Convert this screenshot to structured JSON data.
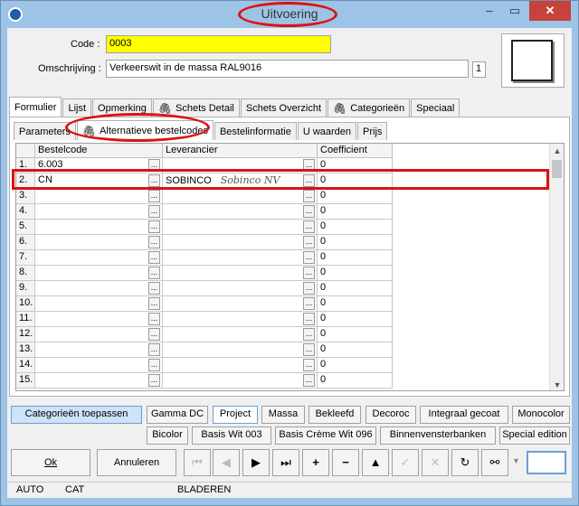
{
  "window": {
    "title": "Uitvoering",
    "close_glyph": "✕",
    "min_glyph": "–",
    "max_glyph": "▭"
  },
  "form": {
    "code_label": "Code :",
    "code_value": "0003",
    "omschrijving_label": "Omschrijving :",
    "omschrijving_value": "Verkeerswit in de massa RAL9016",
    "counter": "1"
  },
  "main_tabs": [
    "Formulier",
    "Lijst",
    "Opmerking",
    "Schets Detail",
    "Schets Overzicht",
    "Categorieën",
    "Speciaal"
  ],
  "sub_tabs": [
    "Parameters",
    "Alternatieve bestelcodes",
    "Bestelinformatie",
    "U waarden",
    "Prijs"
  ],
  "grid": {
    "headers": [
      "Bestelcode",
      "Leverancier",
      "Coefficient"
    ],
    "rows": [
      {
        "n": "1.",
        "code": "6.003",
        "lev": "",
        "lev2": "",
        "coef": "0"
      },
      {
        "n": "2.",
        "code": "CN",
        "lev": "SOBINCO",
        "lev2": "Sobinco NV",
        "coef": "0"
      },
      {
        "n": "3.",
        "code": "",
        "lev": "",
        "lev2": "",
        "coef": "0"
      },
      {
        "n": "4.",
        "code": "",
        "lev": "",
        "lev2": "",
        "coef": "0"
      },
      {
        "n": "5.",
        "code": "",
        "lev": "",
        "lev2": "",
        "coef": "0"
      },
      {
        "n": "6.",
        "code": "",
        "lev": "",
        "lev2": "",
        "coef": "0"
      },
      {
        "n": "7.",
        "code": "",
        "lev": "",
        "lev2": "",
        "coef": "0"
      },
      {
        "n": "8.",
        "code": "",
        "lev": "",
        "lev2": "",
        "coef": "0"
      },
      {
        "n": "9.",
        "code": "",
        "lev": "",
        "lev2": "",
        "coef": "0"
      },
      {
        "n": "10.",
        "code": "",
        "lev": "",
        "lev2": "",
        "coef": "0"
      },
      {
        "n": "11.",
        "code": "",
        "lev": "",
        "lev2": "",
        "coef": "0"
      },
      {
        "n": "12.",
        "code": "",
        "lev": "",
        "lev2": "",
        "coef": "0"
      },
      {
        "n": "13.",
        "code": "",
        "lev": "",
        "lev2": "",
        "coef": "0"
      },
      {
        "n": "14.",
        "code": "",
        "lev": "",
        "lev2": "",
        "coef": "0"
      },
      {
        "n": "15.",
        "code": "",
        "lev": "",
        "lev2": "",
        "coef": "0"
      }
    ],
    "ellipsis": "..."
  },
  "category_buttons": {
    "apply": "Categorieën toepassen",
    "row1": [
      "Gamma DC",
      "Project",
      "Massa",
      "Bekleefd",
      "Decoroc",
      "Integraal gecoat",
      "Monocolor"
    ],
    "row2": [
      "Bicolor",
      "Basis Wit 003",
      "Basis Crème Wit 096",
      "Binnenvensterbanken",
      "Special edition"
    ]
  },
  "actions": {
    "ok": "Ok",
    "cancel": "Annuleren"
  },
  "status": {
    "auto": "AUTO",
    "cat": "CAT",
    "mode": "BLADEREN"
  },
  "colors": {
    "highlight": "#ffff00",
    "annotation_red": "#dd1111",
    "selected_btn": "#cde3f7"
  }
}
